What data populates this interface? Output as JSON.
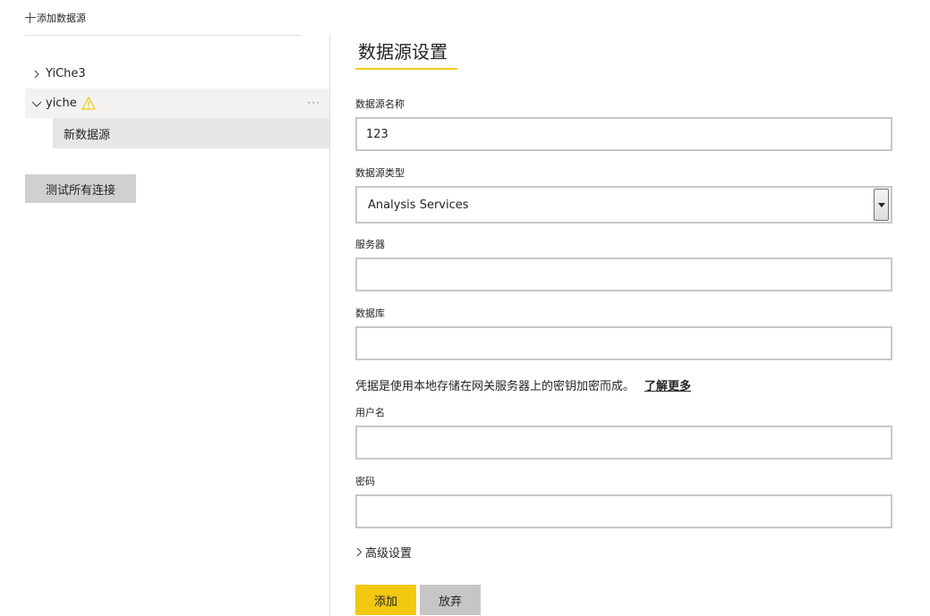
{
  "sidebar": {
    "add_source_label": "添加数据源",
    "gateways": [
      {
        "label": "YiChe3",
        "expanded": false
      },
      {
        "label": "yiche",
        "expanded": true,
        "warning": true,
        "more": "···"
      }
    ],
    "child_source_label": "新数据源",
    "test_all_label": "测试所有连接"
  },
  "settings": {
    "title": "数据源设置",
    "name_label": "数据源名称",
    "name_value": "123",
    "type_label": "数据源类型",
    "type_value": "Analysis Services",
    "server_label": "服务器",
    "server_value": "",
    "database_label": "数据库",
    "database_value": "",
    "credentials_note": "凭据是使用本地存储在网关服务器上的密钥加密而成。",
    "learn_more": "了解更多",
    "username_label": "用户名",
    "username_value": "",
    "password_label": "密码",
    "password_value": "",
    "advanced_label": "高级设置",
    "add_label": "添加",
    "discard_label": "放弃"
  },
  "colors": {
    "accent": "#f2c811",
    "warning": "#f2c811",
    "selected_bg": "#e6e6e6",
    "expanded_bg": "#f3f2f1"
  },
  "icons": [
    "plus-icon",
    "chevron-right-icon",
    "chevron-down-icon",
    "warning-icon",
    "more-icon",
    "dropdown-arrow-icon"
  ]
}
